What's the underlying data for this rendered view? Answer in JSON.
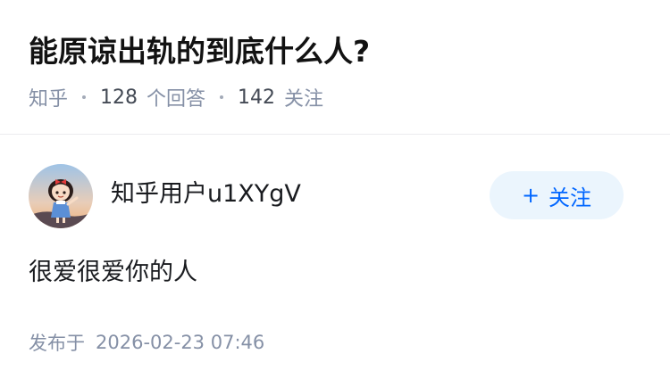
{
  "question": {
    "title": "能原谅出轨的到底什么人?",
    "source": "知乎",
    "answer_count": "128",
    "answer_label": "个回答",
    "follower_count": "142",
    "follower_label": "关注"
  },
  "answer": {
    "author": {
      "name": "知乎用户u1XYgV",
      "avatar_icon": "cartoon-girl-avatar"
    },
    "follow_button": {
      "icon": "plus-icon",
      "label": "关注",
      "color": "#0066ff",
      "background": "#ebf5fd"
    },
    "content": "很爱很爱你的人",
    "published_label": "发布于",
    "published_time": "2026-02-23 07:46"
  },
  "colors": {
    "title": "#121212",
    "meta": "#8590a6",
    "divider": "#ebecef"
  }
}
